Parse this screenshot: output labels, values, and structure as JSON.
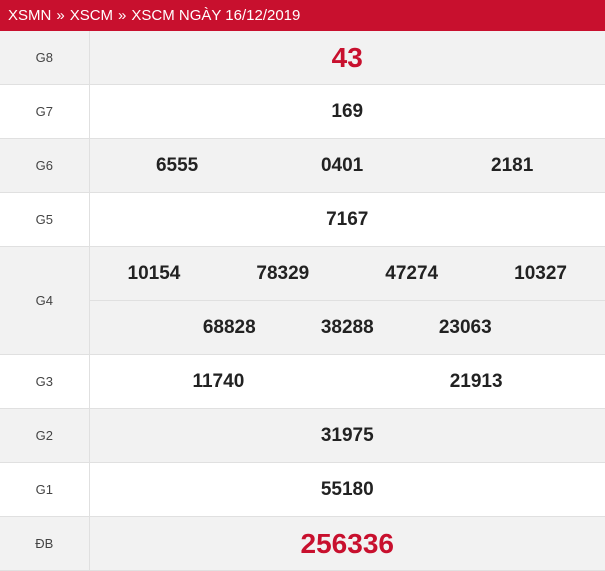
{
  "breadcrumb": {
    "items": [
      "XSMN",
      "XSCM",
      "XSCM NGÀY 16/12/2019"
    ],
    "separator": "»"
  },
  "prizes": {
    "g8": {
      "label": "G8",
      "numbers": [
        "43"
      ]
    },
    "g7": {
      "label": "G7",
      "numbers": [
        "169"
      ]
    },
    "g6": {
      "label": "G6",
      "numbers": [
        "6555",
        "0401",
        "2181"
      ]
    },
    "g5": {
      "label": "G5",
      "numbers": [
        "7167"
      ]
    },
    "g4": {
      "label": "G4",
      "numbers": [
        "10154",
        "78329",
        "47274",
        "10327",
        "68828",
        "38288",
        "23063"
      ]
    },
    "g3": {
      "label": "G3",
      "numbers": [
        "11740",
        "21913"
      ]
    },
    "g2": {
      "label": "G2",
      "numbers": [
        "31975"
      ]
    },
    "g1": {
      "label": "G1",
      "numbers": [
        "55180"
      ]
    },
    "db": {
      "label": "ĐB",
      "numbers": [
        "256336"
      ]
    }
  },
  "colors": {
    "brand": "#c8102e",
    "row_shade": "#f2f2f2"
  }
}
